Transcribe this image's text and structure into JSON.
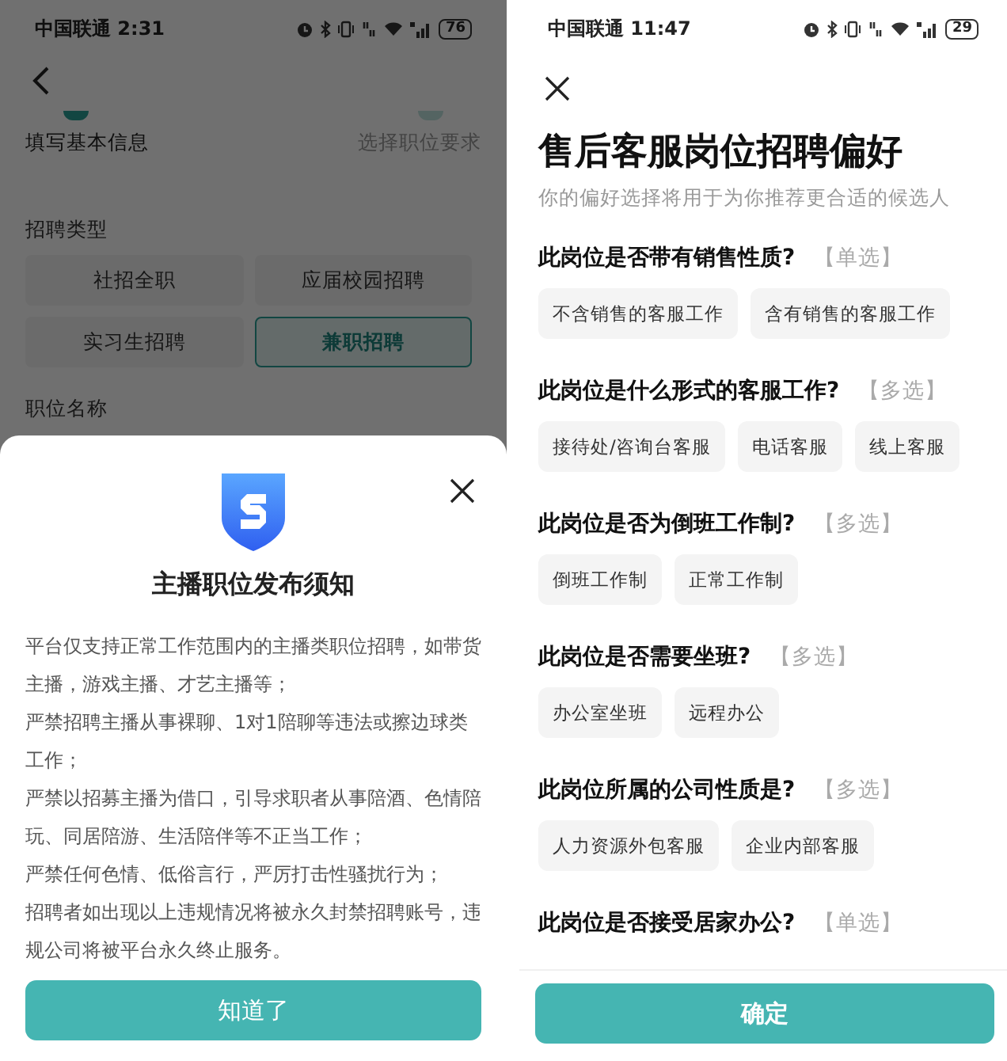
{
  "left_screen": {
    "status_bar": {
      "carrier_time": "中国联通 2:31",
      "battery": "76",
      "alarm": true
    },
    "steps": [
      {
        "label": "填写基本信息",
        "active": true
      },
      {
        "label": "选择职位要求",
        "active": false
      }
    ],
    "recruit_type": {
      "label": "招聘类型",
      "options": [
        {
          "label": "社招全职",
          "selected": false
        },
        {
          "label": "应届校园招聘",
          "selected": false
        },
        {
          "label": "实习生招聘",
          "selected": false
        },
        {
          "label": "兼职招聘",
          "selected": true
        }
      ]
    },
    "position_name_label": "职位名称",
    "dialog": {
      "title": "主播职位发布须知",
      "paragraphs": [
        "平台仅支持正常工作范围内的主播类职位招聘，如带货主播，游戏主播、才艺主播等；",
        "严禁招聘主播从事裸聊、1对1陪聊等违法或擦边球类工作；",
        "严禁以招募主播为借口，引导求职者从事陪酒、色情陪玩、同居陪游、生活陪伴等不正当工作；",
        "严禁任何色情、低俗言行，严厉打击性骚扰行为；",
        "招聘者如出现以上违规情况将被永久封禁招聘账号，违规公司将被平台永久终止服务。"
      ],
      "button": "知道了"
    }
  },
  "right_screen": {
    "status_bar": {
      "carrier_time": "中国联通 11:47",
      "battery": "29",
      "alarm": true
    },
    "title": "售后客服岗位招聘偏好",
    "subtitle": "你的偏好选择将用于为你推荐更合适的候选人",
    "questions": [
      {
        "question": "此岗位是否带有销售性质?",
        "mode": "【单选】",
        "options": [
          {
            "label": "不含销售的客服工作",
            "selected": false
          },
          {
            "label": "含有销售的客服工作",
            "selected": false
          }
        ]
      },
      {
        "question": "此岗位是什么形式的客服工作?",
        "mode": "【多选】",
        "options": [
          {
            "label": "接待处/咨询台客服",
            "selected": false
          },
          {
            "label": "电话客服",
            "selected": false
          },
          {
            "label": "线上客服",
            "selected": false
          }
        ]
      },
      {
        "question": "此岗位是否为倒班工作制?",
        "mode": "【多选】",
        "options": [
          {
            "label": "倒班工作制",
            "selected": false
          },
          {
            "label": "正常工作制",
            "selected": false
          }
        ]
      },
      {
        "question": "此岗位是否需要坐班?",
        "mode": "【多选】",
        "options": [
          {
            "label": "办公室坐班",
            "selected": false
          },
          {
            "label": "远程办公",
            "selected": false
          }
        ]
      },
      {
        "question": "此岗位所属的公司性质是?",
        "mode": "【多选】",
        "options": [
          {
            "label": "人力资源外包客服",
            "selected": false
          },
          {
            "label": "企业内部客服",
            "selected": false
          }
        ]
      },
      {
        "question": "此岗位是否接受居家办公?",
        "mode": "【单选】"
      }
    ],
    "button": "确定"
  }
}
